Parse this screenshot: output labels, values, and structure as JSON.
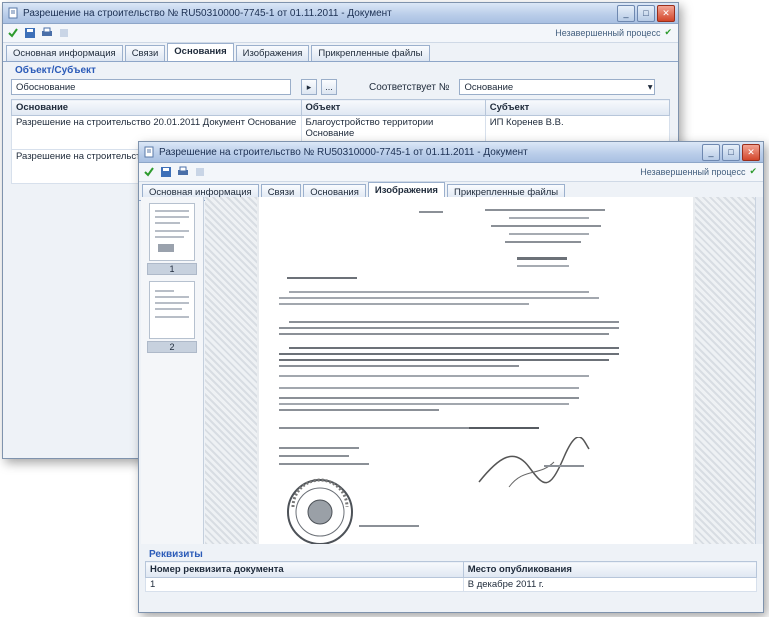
{
  "back_window": {
    "title": "Разрешение на строительство № RU50310000-7745-1 от 01.11.2011 - Документ",
    "toolbar_right": "Незавершенный процесс",
    "tabs": [
      "Основная информация",
      "Связи",
      "Основания",
      "Изображения",
      "Прикрепленные файлы"
    ],
    "active_tab": 2,
    "group_title": "Объект/Субъект",
    "object_field": "Обоснование",
    "object_btn": "...",
    "relation_label": "Соответствует №",
    "relation_value": "Основание",
    "columns": [
      "Основание",
      "Объект",
      "Субъект"
    ],
    "rows": [
      [
        "Разрешение на строительство 20.01.2011 Документ Основание",
        "Благоустройство территории Основание",
        "ИП Коренев В.В."
      ],
      [
        "Разрешение на строительство 20.01.2011 Документ Основание",
        "",
        ""
      ]
    ]
  },
  "front_window": {
    "title": "Разрешение на строительство № RU50310000-7745-1 от 01.11.2011 - Документ",
    "toolbar_right": "Незавершенный процесс",
    "tabs": [
      "Основная информация",
      "Связи",
      "Основания",
      "Изображения",
      "Прикрепленные файлы"
    ],
    "active_tab": 3,
    "thumbnails": [
      {
        "num": "1"
      },
      {
        "num": "2"
      }
    ],
    "bottom_title": "Реквизиты",
    "bottom_columns": [
      "Номер реквизита документа",
      "Место опубликования"
    ],
    "bottom_row": [
      "1",
      "В декабре 2011 г."
    ]
  },
  "colors": {
    "accent": "#2b5bb8",
    "title_bar": "#b9cde9",
    "close": "#d2462a"
  }
}
